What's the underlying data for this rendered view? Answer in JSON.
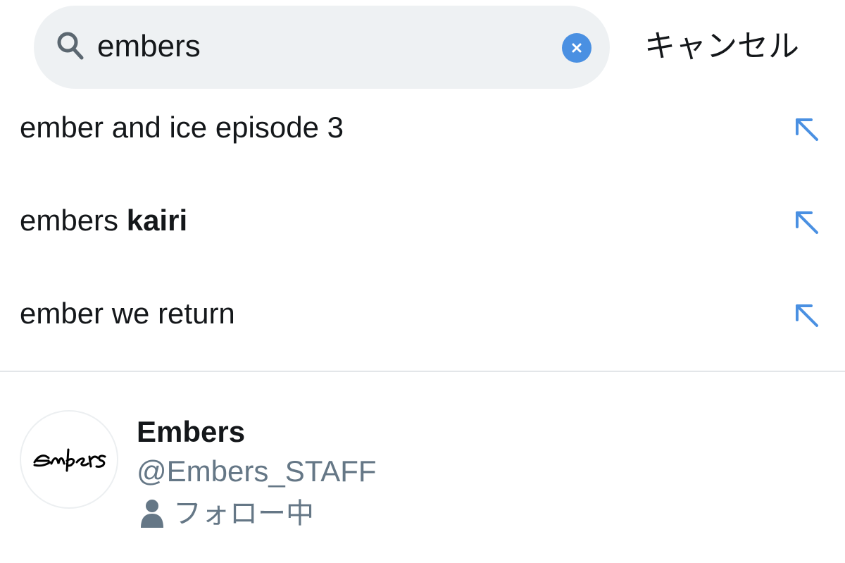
{
  "search": {
    "query": "embers",
    "cancel_label": "キャンセル",
    "search_icon": "magnifier",
    "clear_icon": "clear-x"
  },
  "suggestions": [
    {
      "prefix": "ember and ice episode 3",
      "bold": "",
      "icon": "arrow-up-left"
    },
    {
      "prefix": "embers ",
      "bold": "kairi",
      "icon": "arrow-up-left"
    },
    {
      "prefix": "ember we return",
      "bold": "",
      "icon": "arrow-up-left"
    }
  ],
  "user_result": {
    "display_name": "Embers",
    "handle": "@Embers_STAFF",
    "follow_status": "フォロー中",
    "avatar_logo_text": "Embers",
    "status_icon": "person"
  },
  "colors": {
    "search_bg": "#eef1f3",
    "accent": "#4a90e2",
    "secondary_text": "#657786",
    "primary_text": "#14171a",
    "divider": "#e3e6e9"
  }
}
